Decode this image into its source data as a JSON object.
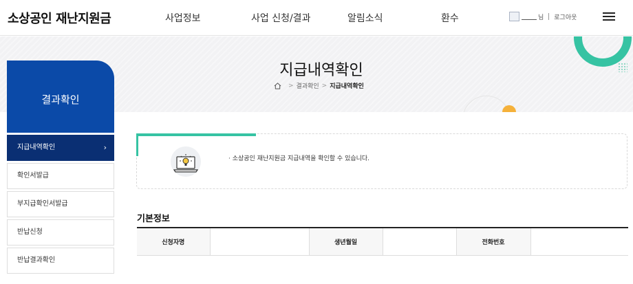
{
  "header": {
    "logo": "소상공인 재난지원금",
    "nav": [
      "사업정보",
      "사업 신청/결과",
      "알림소식",
      "환수"
    ],
    "user_suffix": "님",
    "logout": "로그아웃"
  },
  "banner": {
    "title": "지급내역확인",
    "breadcrumb": [
      "결과확인",
      "지급내역확인"
    ]
  },
  "sidebar": {
    "heading": "결과확인",
    "items": [
      {
        "label": "지급내역확인",
        "active": true
      },
      {
        "label": "확인서발급"
      },
      {
        "label": "부지급확인서발급"
      },
      {
        "label": "반납신청"
      },
      {
        "label": "반납결과확인"
      }
    ]
  },
  "notice": {
    "text": "· 소상공인 재난지원금 지급내역을 확인할 수 있습니다."
  },
  "basic_info": {
    "title": "기본정보",
    "headers": [
      "신청자명",
      "생년월일",
      "전화번호"
    ],
    "values": [
      "",
      "",
      ""
    ]
  },
  "colors": {
    "primary": "#0b4aa8",
    "active": "#0a2f73",
    "accent": "#36c3a3"
  }
}
